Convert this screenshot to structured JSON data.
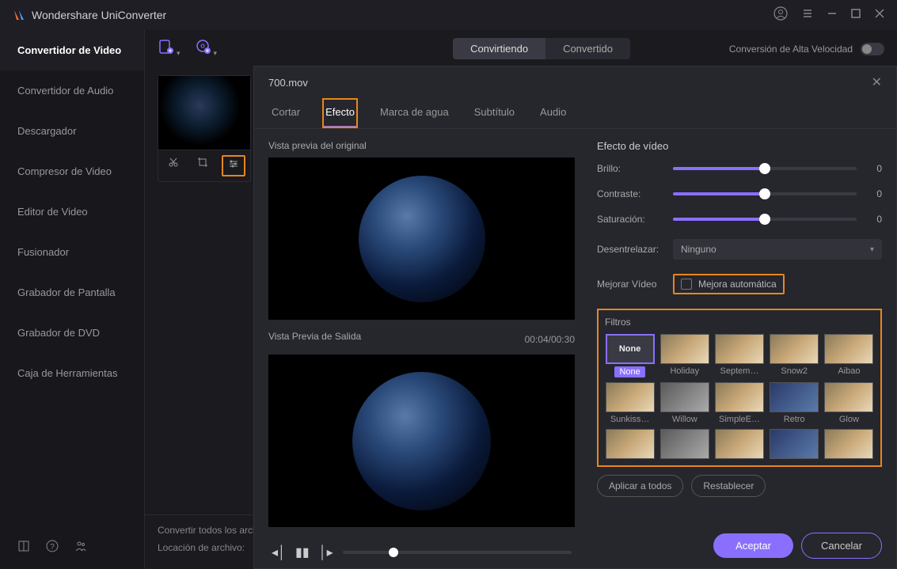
{
  "app": {
    "title": "Wondershare UniConverter"
  },
  "sidebar": {
    "items": [
      "Convertidor de Video",
      "Convertidor de Audio",
      "Descargador",
      "Compresor de Video",
      "Editor de Video",
      "Fusionador",
      "Grabador de Pantalla",
      "Grabador de DVD",
      "Caja de Herramientas"
    ]
  },
  "tabs": {
    "converting": "Convirtiendo",
    "converted": "Convertido"
  },
  "speed_label": "Conversión de Alta Velocidad",
  "footer": {
    "convert_all": "Convertir todos los archi",
    "location": "Locación de archivo:"
  },
  "modal": {
    "filename": "700.mov",
    "tabs": {
      "cut": "Cortar",
      "effect": "Efecto",
      "watermark": "Marca de agua",
      "subtitle": "Subtítulo",
      "audio": "Audio"
    },
    "preview_original": "Vista previa del original",
    "preview_output": "Vista Previa de Salida",
    "timecode": "00:04/00:30",
    "effect_title": "Efecto de vídeo",
    "brightness": {
      "label": "Brillo:",
      "value": "0"
    },
    "contrast": {
      "label": "Contraste:",
      "value": "0"
    },
    "saturation": {
      "label": "Saturación:",
      "value": "0"
    },
    "deinterlace": {
      "label": "Desentrelazar:",
      "value": "Ninguno"
    },
    "enhance": {
      "label": "Mejorar Vídeo",
      "checkbox": "Mejora automática"
    },
    "filters_title": "Filtros",
    "filters": [
      "None",
      "Holiday",
      "Septem…",
      "Snow2",
      "Aibao",
      "Sunkiss…",
      "Willow",
      "SimpleE…",
      "Retro",
      "Glow"
    ],
    "apply_all": "Aplicar a todos",
    "reset": "Restablecer",
    "accept": "Aceptar",
    "cancel": "Cancelar",
    "none_label": "None"
  }
}
